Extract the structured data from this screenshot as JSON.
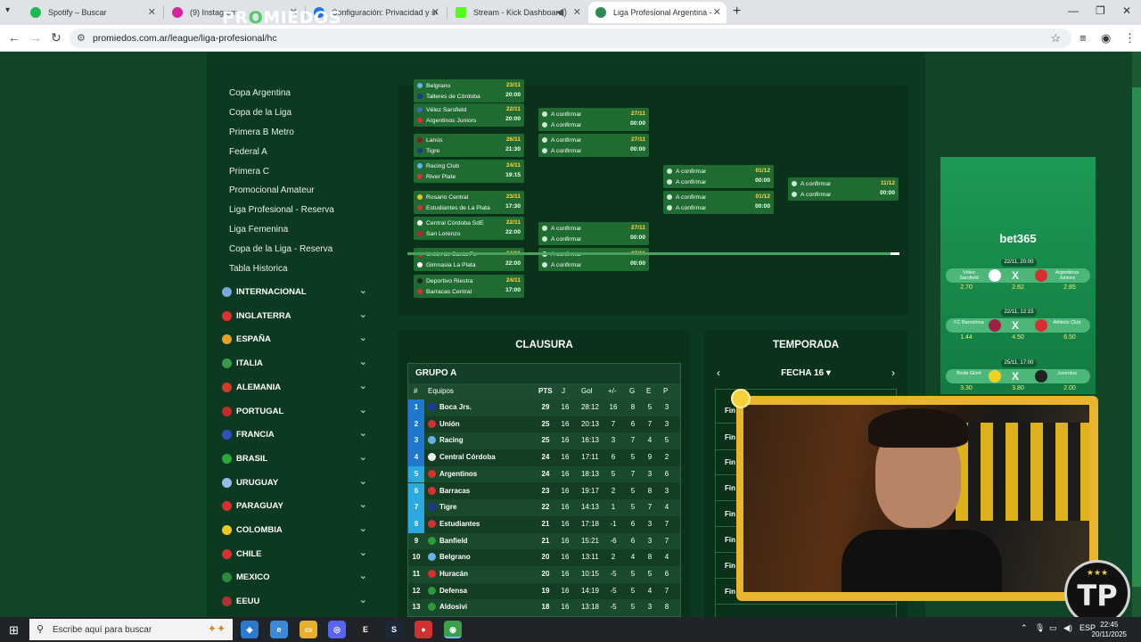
{
  "browser": {
    "tabs": [
      {
        "title": "Spotify – Buscar",
        "color": "#1db954"
      },
      {
        "title": "(9) Instagram",
        "color": "#d6249f"
      },
      {
        "title": "Configuración: Privacidad y seg",
        "color": "#1a73e8"
      },
      {
        "title": "Stream - Kick Dashboard",
        "color": "#53fc18"
      },
      {
        "title": "Liga Profesional Argentina - PC",
        "color": "#2e8b4e"
      }
    ],
    "url": "promiedos.com.ar/league/liga-profesional/hc"
  },
  "site": {
    "logo_prefix": "PR",
    "logo_o": "O",
    "logo_suffix": "MIEDOS",
    "sublinks": [
      "Copa Argentina",
      "Copa de la Liga",
      "Primera B Metro",
      "Federal A",
      "Primera C",
      "Promocional Amateur",
      "Liga Profesional - Reserva",
      "Liga Femenina",
      "Copa de la Liga - Reserva",
      "Tabla Historica"
    ],
    "countries": [
      {
        "name": "INTERNACIONAL",
        "color": "#7aa8d8"
      },
      {
        "name": "INGLATERRA",
        "color": "#e03030"
      },
      {
        "name": "ESPAÑA",
        "color": "#e8a020"
      },
      {
        "name": "ITALIA",
        "color": "#3a9a4a"
      },
      {
        "name": "ALEMANIA",
        "color": "#d43a2a"
      },
      {
        "name": "PORTUGAL",
        "color": "#c82828"
      },
      {
        "name": "FRANCIA",
        "color": "#3050c0"
      },
      {
        "name": "BRASIL",
        "color": "#2aa83a"
      },
      {
        "name": "URUGUAY",
        "color": "#9ab8e8"
      },
      {
        "name": "PARAGUAY",
        "color": "#d83030"
      },
      {
        "name": "COLOMBIA",
        "color": "#f0c820"
      },
      {
        "name": "CHILE",
        "color": "#d83030"
      },
      {
        "name": "MEXICO",
        "color": "#2a8a3a"
      },
      {
        "name": "EEUU",
        "color": "#b03030"
      }
    ]
  },
  "bracket": {
    "r16": [
      {
        "t1": "Belgrano",
        "t2": "Talleres de Córdoba",
        "date": "23/11",
        "time": "20:00",
        "c1": "#6ab0e8",
        "c2": "#1a3a8a"
      },
      {
        "t1": "Vélez Sarsfield",
        "t2": "Argentinos Juniors",
        "date": "22/11",
        "time": "20:00",
        "c1": "#3a6ac8",
        "c2": "#d83030"
      },
      {
        "t1": "Lanús",
        "t2": "Tigre",
        "date": "26/11",
        "time": "21:30",
        "c1": "#8a1a2a",
        "c2": "#1a3a8a"
      },
      {
        "t1": "Racing Club",
        "t2": "River Plate",
        "date": "24/11",
        "time": "19:15",
        "c1": "#6ab0e8",
        "c2": "#d83030"
      },
      {
        "t1": "Rosario Central",
        "t2": "Estudiantes de La Plata",
        "date": "23/11",
        "time": "17:30",
        "c1": "#e8c020",
        "c2": "#d83030"
      },
      {
        "t1": "Central Córdoba SdE",
        "t2": "San Lorenzo",
        "date": "22/11",
        "time": "22:00",
        "c1": "#ffffff",
        "c2": "#c02030"
      },
      {
        "t1": "Unión de Santa Fe",
        "t2": "Gimnasia La Plata",
        "date": "24/11",
        "time": "22:00",
        "c1": "#d83030",
        "c2": "#ffffff"
      },
      {
        "t1": "Deportivo Riestra",
        "t2": "Barracas Central",
        "date": "24/11",
        "time": "17:00",
        "c1": "#222222",
        "c2": "#d83030"
      }
    ],
    "qf": [
      {
        "t1": "A confirmar",
        "t2": "A confirmar",
        "date": "27/11",
        "time": "00:00"
      },
      {
        "t1": "A confirmar",
        "t2": "A confirmar",
        "date": "27/11",
        "time": "00:00"
      },
      {
        "t1": "A confirmar",
        "t2": "A confirmar",
        "date": "27/11",
        "time": "00:00"
      },
      {
        "t1": "A confirmar",
        "t2": "A confirmar",
        "date": "27/11",
        "time": "00:00"
      }
    ],
    "sf": [
      {
        "t1": "A confirmar",
        "t2": "A confirmar",
        "date": "01/12",
        "time": "00:00"
      },
      {
        "t1": "A confirmar",
        "t2": "A confirmar",
        "date": "01/12",
        "time": "00:00"
      }
    ],
    "final": [
      {
        "t1": "A confirmar",
        "t2": "A confirmar",
        "date": "11/12",
        "time": "00:00"
      }
    ]
  },
  "clausura": {
    "title": "CLAUSURA",
    "group": "GRUPO A",
    "headers": {
      "num": "#",
      "team": "Equipos",
      "pts": "PTS",
      "j": "J",
      "gol": "Gol",
      "dif": "+/-",
      "g": "G",
      "e": "E",
      "p": "P"
    },
    "rows": [
      {
        "pos": "1",
        "team": "Boca Jrs.",
        "pts": "29",
        "j": "16",
        "gol": "28:12",
        "dif": "16",
        "g": "8",
        "e": "5",
        "p": "3",
        "posc": "#1e78d0",
        "logo": "#1a3a9a"
      },
      {
        "pos": "2",
        "team": "Unión",
        "pts": "25",
        "j": "16",
        "gol": "20:13",
        "dif": "7",
        "g": "6",
        "e": "7",
        "p": "3",
        "posc": "#1e78d0",
        "logo": "#d83030"
      },
      {
        "pos": "3",
        "team": "Racing",
        "pts": "25",
        "j": "16",
        "gol": "16:13",
        "dif": "3",
        "g": "7",
        "e": "4",
        "p": "5",
        "posc": "#1e78d0",
        "logo": "#6ab0e8"
      },
      {
        "pos": "4",
        "team": "Central Córdoba",
        "pts": "24",
        "j": "16",
        "gol": "17:11",
        "dif": "6",
        "g": "5",
        "e": "9",
        "p": "2",
        "posc": "#1e78d0",
        "logo": "#eeeeee"
      },
      {
        "pos": "5",
        "team": "Argentinos",
        "pts": "24",
        "j": "16",
        "gol": "18:13",
        "dif": "5",
        "g": "7",
        "e": "3",
        "p": "6",
        "posc": "#2aa8e0",
        "logo": "#d83030"
      },
      {
        "pos": "6",
        "team": "Barracas",
        "pts": "23",
        "j": "16",
        "gol": "19:17",
        "dif": "2",
        "g": "5",
        "e": "8",
        "p": "3",
        "posc": "#2aa8e0",
        "logo": "#d83030"
      },
      {
        "pos": "7",
        "team": "Tigre",
        "pts": "22",
        "j": "16",
        "gol": "14:13",
        "dif": "1",
        "g": "5",
        "e": "7",
        "p": "4",
        "posc": "#2aa8e0",
        "logo": "#1a3a8a"
      },
      {
        "pos": "8",
        "team": "Estudiantes",
        "pts": "21",
        "j": "16",
        "gol": "17:18",
        "dif": "-1",
        "g": "6",
        "e": "3",
        "p": "7",
        "posc": "#2aa8e0",
        "logo": "#d83030"
      },
      {
        "pos": "9",
        "team": "Banfield",
        "pts": "21",
        "j": "16",
        "gol": "15:21",
        "dif": "-6",
        "g": "6",
        "e": "3",
        "p": "7",
        "posc": "",
        "logo": "#2a9a3a"
      },
      {
        "pos": "10",
        "team": "Belgrano",
        "pts": "20",
        "j": "16",
        "gol": "13:11",
        "dif": "2",
        "g": "4",
        "e": "8",
        "p": "4",
        "posc": "",
        "logo": "#6ab0e8"
      },
      {
        "pos": "11",
        "team": "Huracán",
        "pts": "20",
        "j": "16",
        "gol": "10:15",
        "dif": "-5",
        "g": "5",
        "e": "5",
        "p": "6",
        "posc": "",
        "logo": "#d83030"
      },
      {
        "pos": "12",
        "team": "Defensa",
        "pts": "19",
        "j": "16",
        "gol": "14:19",
        "dif": "-5",
        "g": "5",
        "e": "4",
        "p": "7",
        "posc": "",
        "logo": "#2a9a3a"
      },
      {
        "pos": "13",
        "team": "Aldosivi",
        "pts": "18",
        "j": "16",
        "gol": "13:18",
        "dif": "-5",
        "g": "5",
        "e": "3",
        "p": "8",
        "posc": "",
        "logo": "#2a9a3a"
      }
    ]
  },
  "temporada": {
    "title": "TEMPORADA",
    "fecha": "FECHA 16 ▾",
    "rows": [
      "Fin",
      "Fin",
      "Fin",
      "Fin",
      "Fin",
      "Fin",
      "Fin",
      "Fin"
    ]
  },
  "ad": {
    "brand_main": "bet365",
    "brand_tail": "",
    "games": [
      {
        "date": "22/11, 20:00",
        "t1": "Vélez Sarsfield",
        "t2": "Argentinos Juniors",
        "o1": "2.70",
        "ox": "2.82",
        "o2": "2.85",
        "c1": "#ffffff",
        "c2": "#d83030"
      },
      {
        "date": "22/11, 12:15",
        "t1": "FC Barcelona",
        "t2": "Athletic Club",
        "o1": "1.44",
        "ox": "4.50",
        "o2": "6.50",
        "c1": "#a0204a",
        "c2": "#d83030"
      },
      {
        "date": "25/11, 17:00",
        "t1": "Bodø Glimt",
        "t2": "Juventus",
        "o1": "3.30",
        "ox": "3.80",
        "o2": "2.00",
        "c1": "#f0d020",
        "c2": "#222222"
      }
    ]
  },
  "stream": {
    "badge_stars": "★★★",
    "badge_text": "TP"
  },
  "taskbar": {
    "search_placeholder": "Escribe aquí para buscar",
    "lang": "ESP",
    "time": "22:45",
    "date": "20/11/2025"
  }
}
